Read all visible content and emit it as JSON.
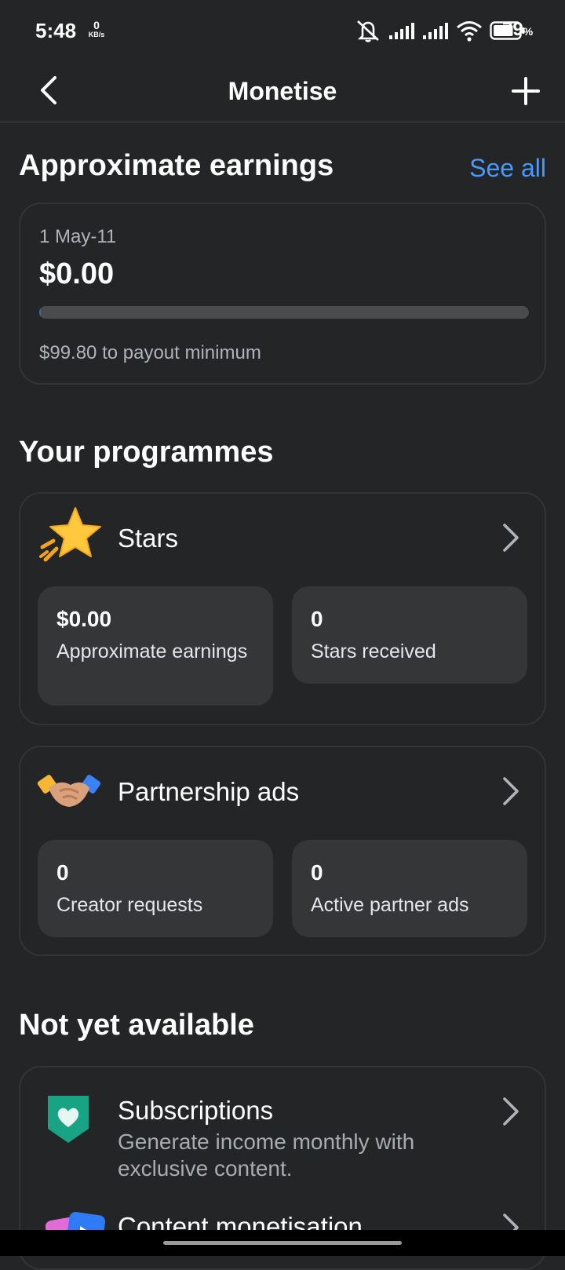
{
  "status_bar": {
    "time": "5:48",
    "net_speed_value": "0",
    "net_speed_unit": "KB/s",
    "battery_percent": "79",
    "battery_unit": "%",
    "battery_level": 0.79
  },
  "app_bar": {
    "title": "Monetise"
  },
  "earnings": {
    "title": "Approximate earnings",
    "see_all": "See all",
    "date_range": "1 May-11",
    "amount": "$0.00",
    "progress": 0.002,
    "payout_note": "$99.80 to payout minimum"
  },
  "programmes": {
    "title": "Your programmes",
    "stars": {
      "label": "Stars",
      "stats": [
        {
          "value": "$0.00",
          "label": "Approximate earnings"
        },
        {
          "value": "0",
          "label": "Stars received"
        }
      ]
    },
    "partnership": {
      "label": "Partnership ads",
      "stats": [
        {
          "value": "0",
          "label": "Creator requests"
        },
        {
          "value": "0",
          "label": "Active partner ads"
        }
      ]
    }
  },
  "not_available": {
    "title": "Not yet available",
    "items": [
      {
        "title": "Subscriptions",
        "subtitle": "Generate income monthly with exclusive content."
      },
      {
        "title": "Content monetisation",
        "subtitle": ""
      }
    ]
  },
  "colors": {
    "background": "#242526",
    "card_inner": "#353638",
    "accent_link": "#4599ff",
    "progress_fill": "#1f6fd6"
  }
}
